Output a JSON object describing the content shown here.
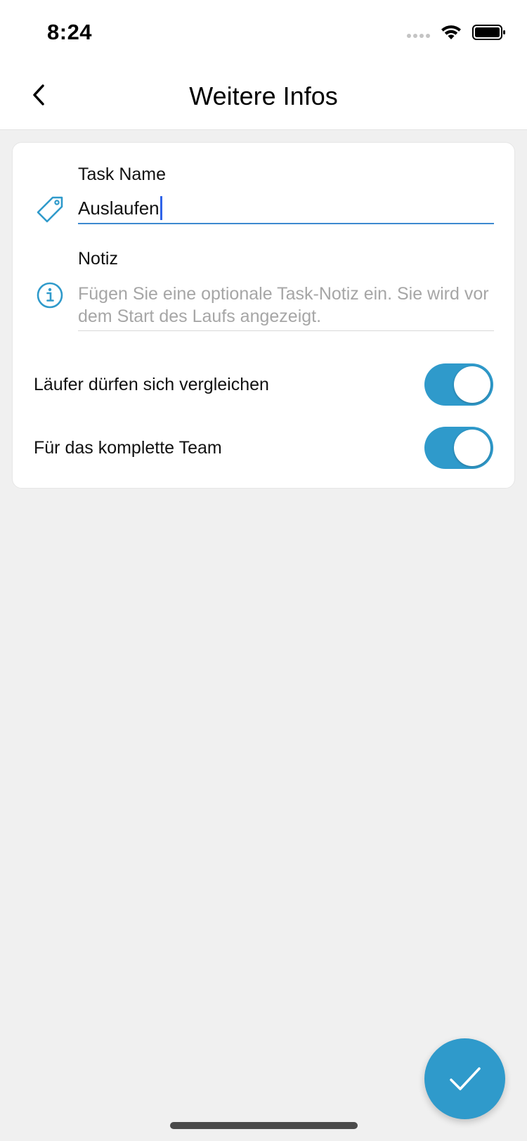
{
  "status_bar": {
    "time": "8:24"
  },
  "nav": {
    "title": "Weitere Infos",
    "back_icon": "chevron-left-icon"
  },
  "form": {
    "task_name": {
      "label": "Task Name",
      "value": "Auslaufen",
      "icon": "tag-icon"
    },
    "note": {
      "label": "Notiz",
      "placeholder": "Fügen Sie eine optionale Task-Notiz ein. Sie wird vor dem Start des Laufs angezeigt.",
      "icon": "info-icon"
    },
    "toggles": [
      {
        "label": "Läufer dürfen sich vergleichen",
        "on": true
      },
      {
        "label": "Für das komplette Team",
        "on": true
      }
    ]
  },
  "fab": {
    "icon": "checkmark-icon"
  },
  "colors": {
    "accent": "#2f9acb",
    "input_underline": "#3d8ad0",
    "caret": "#2f63e8",
    "background": "#f0f0f0"
  }
}
